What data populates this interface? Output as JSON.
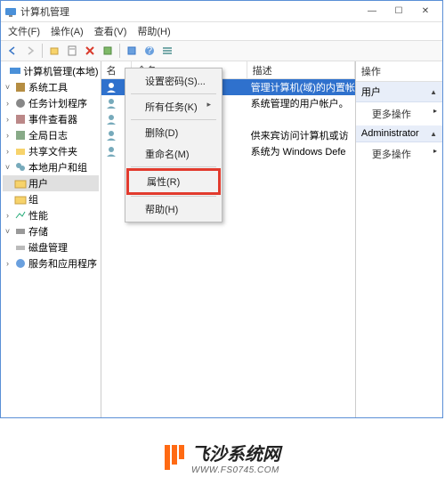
{
  "title": "计算机管理",
  "menu": {
    "file": "文件(F)",
    "action": "操作(A)",
    "view": "查看(V)",
    "help": "帮助(H)"
  },
  "tree": {
    "root": "计算机管理(本地)",
    "systools": "系统工具",
    "task": "任务计划程序",
    "event": "事件查看器",
    "global": "全局日志",
    "share": "共享文件夹",
    "localug": "本地用户和组",
    "users_folder": "用户",
    "groups_folder": "组",
    "perf": "性能",
    "storage": "存储",
    "disk": "磁盘管理",
    "services": "服务和应用程序"
  },
  "list": {
    "col_name": "名称",
    "col_full": "全名",
    "col_desc": "描述",
    "rows": [
      {
        "desc": "管理计算机(域)的内置帐"
      },
      {
        "desc": "系统管理的用户帐户。"
      },
      {
        "desc": ""
      },
      {
        "desc": "供来宾访问计算机或访"
      },
      {
        "desc": "系统为 Windows Defe"
      }
    ]
  },
  "ctx": {
    "setpw": "设置密码(S)...",
    "alltask": "所有任务(K)",
    "delete": "删除(D)",
    "rename": "重命名(M)",
    "props": "属性(R)",
    "help": "帮助(H)"
  },
  "actions": {
    "header": "操作",
    "grp1": "用户",
    "more1": "更多操作",
    "grp2": "Administrator",
    "more2": "更多操作"
  },
  "watermark": {
    "cn": "飞沙系统网",
    "en": "WWW.FS0745.COM"
  }
}
